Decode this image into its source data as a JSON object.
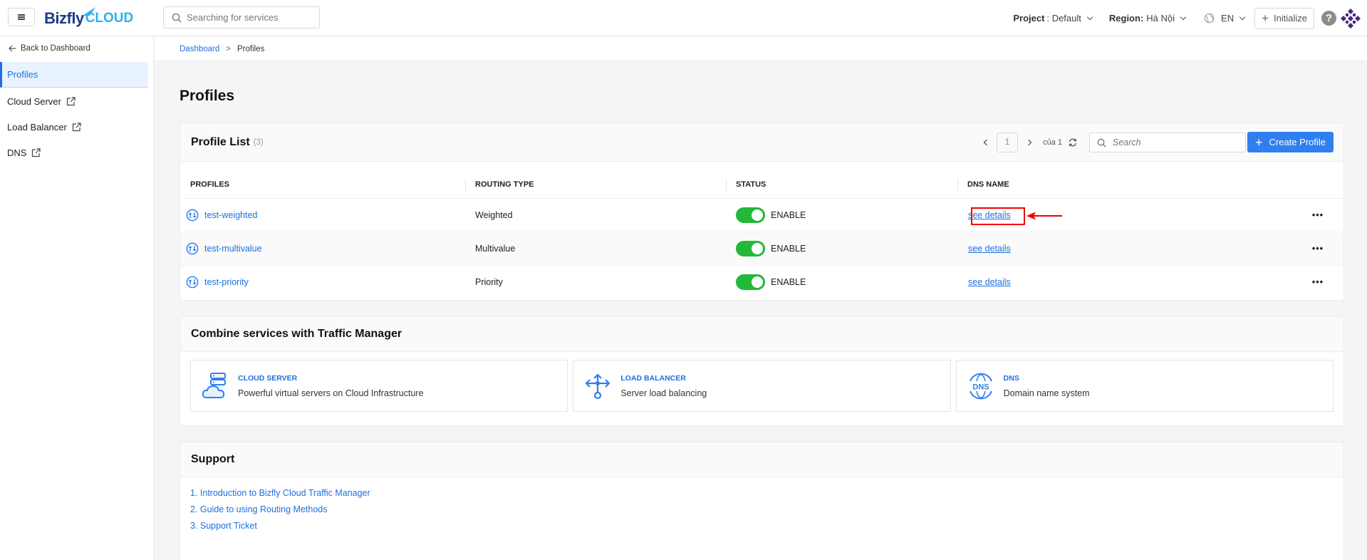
{
  "header": {
    "logo_main": "Bizfly",
    "logo_sub": "CLOUD",
    "search_placeholder": "Searching for services",
    "project_label": "Project",
    "project_value": ": Default",
    "region_label": "Region:",
    "region_value": "Hà Nội",
    "language": "EN",
    "initialize_label": "Initialize",
    "help_label": "?"
  },
  "sidebar": {
    "back_label": "Back to Dashboard",
    "items": [
      {
        "label": "Profiles",
        "active": true,
        "external": false
      },
      {
        "label": "Cloud Server",
        "active": false,
        "external": true
      },
      {
        "label": "Load Balancer",
        "active": false,
        "external": true
      },
      {
        "label": "DNS",
        "active": false,
        "external": true
      }
    ]
  },
  "breadcrumb": {
    "parent": "Dashboard",
    "separator": ">",
    "current": "Profiles"
  },
  "page_title": "Profiles",
  "profile_list": {
    "title": "Profile List",
    "count": "(3)",
    "pagination": {
      "page": "1",
      "of_label": "của 1"
    },
    "search_placeholder": "Search",
    "create_label": "Create Profile",
    "columns": [
      "PROFILES",
      "ROUTING TYPE",
      "STATUS",
      "DNS NAME"
    ],
    "rows": [
      {
        "name": "test-weighted",
        "routing": "Weighted",
        "status": "ENABLE",
        "dns": "see details",
        "enabled": true
      },
      {
        "name": "test-multivalue",
        "routing": "Multivalue",
        "status": "ENABLE",
        "dns": "see details",
        "enabled": true
      },
      {
        "name": "test-priority",
        "routing": "Priority",
        "status": "ENABLE",
        "dns": "see details",
        "enabled": true
      }
    ],
    "more_label": "•••"
  },
  "combine": {
    "title": "Combine services with Traffic Manager",
    "services": [
      {
        "title": "CLOUD SERVER",
        "desc": "Powerful virtual servers on Cloud Infrastructure",
        "icon": "cloud-server-icon"
      },
      {
        "title": "LOAD BALANCER",
        "desc": "Server load balancing",
        "icon": "load-balancer-icon"
      },
      {
        "title": "DNS",
        "desc": "Domain name system",
        "icon": "dns-globe-icon"
      }
    ]
  },
  "support": {
    "title": "Support",
    "links": [
      "1. Introduction to Bizfly Cloud Traffic Manager",
      "2. Guide to using Routing Methods",
      "3. Support Ticket"
    ]
  },
  "colors": {
    "primary": "#1f6fe0",
    "button": "#2f7ff0",
    "toggle_on": "#22b83a",
    "annotation": "#ee0000"
  }
}
